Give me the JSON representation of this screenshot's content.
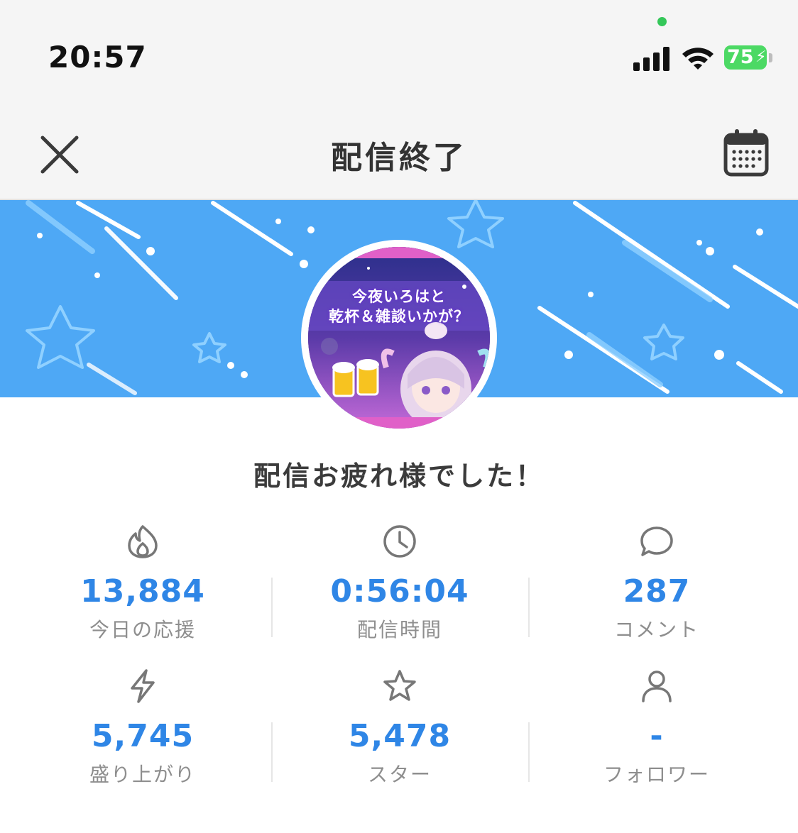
{
  "status_bar": {
    "time": "20:57",
    "battery": "75"
  },
  "nav": {
    "title": "配信終了"
  },
  "thumbnail": {
    "line1": "今夜いろはと",
    "line2": "乾杯＆雑談いかが？"
  },
  "heading": "配信お疲れ様でした！",
  "stats": [
    {
      "icon": "flame-icon",
      "value": "13,884",
      "label": "今日の応援"
    },
    {
      "icon": "clock-icon",
      "value": "0:56:04",
      "label": "配信時間"
    },
    {
      "icon": "chat-bubble-icon",
      "value": "287",
      "label": "コメント"
    },
    {
      "icon": "lightning-icon",
      "value": "5,745",
      "label": "盛り上がり"
    },
    {
      "icon": "star-icon",
      "value": "5,478",
      "label": "スター"
    },
    {
      "icon": "person-icon",
      "value": "-",
      "label": "フォロワー"
    }
  ],
  "colors": {
    "accent": "#2f86e6",
    "banner": "#4ea8f5",
    "battery": "#4cd964"
  }
}
